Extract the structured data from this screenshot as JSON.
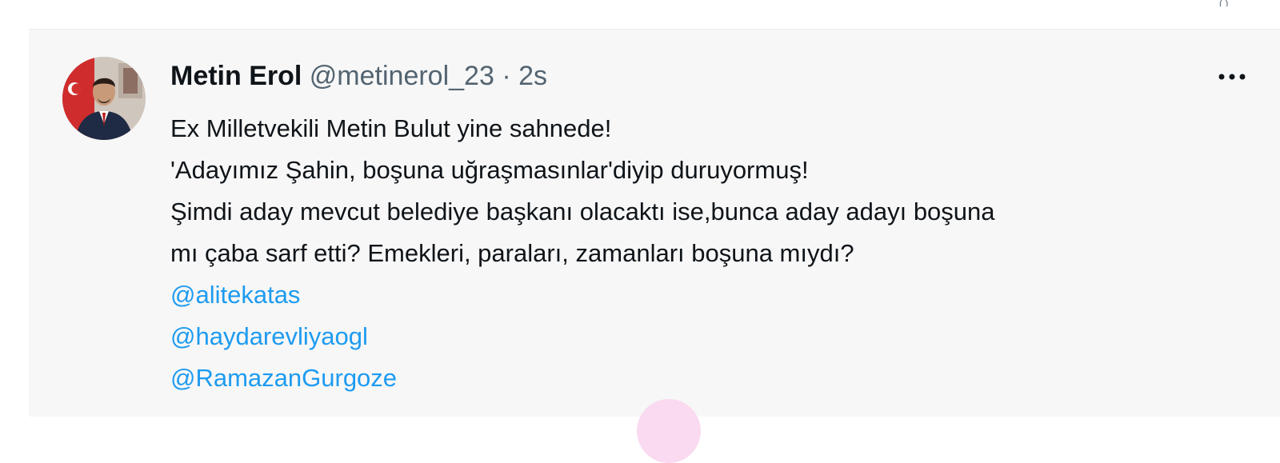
{
  "tweet": {
    "display_name": "Metin Erol",
    "handle": "@metinerol_23",
    "separator": "·",
    "time": "2s",
    "more_icon": "more-horizontal-icon",
    "text_lines": [
      "Ex Milletvekili Metin Bulut yine sahnede!",
      "'Adayımız Şahin, boşuna uğraşmasınlar'diyip duruyormuş!",
      "Şimdi aday mevcut belediye başkanı olacaktı ise,bunca aday adayı boşuna",
      "mı çaba sarf etti? Emekleri, paraları, zamanları boşuna mıydı?"
    ],
    "mentions": [
      "@alitekatas",
      "@haydarevliyaogl",
      "@RamazanGurgoze"
    ]
  },
  "colors": {
    "tweet_background": "#f7f7f7",
    "primary_text": "#0f1419",
    "secondary_text": "#536471",
    "mention_link": "#1d9bf0"
  }
}
